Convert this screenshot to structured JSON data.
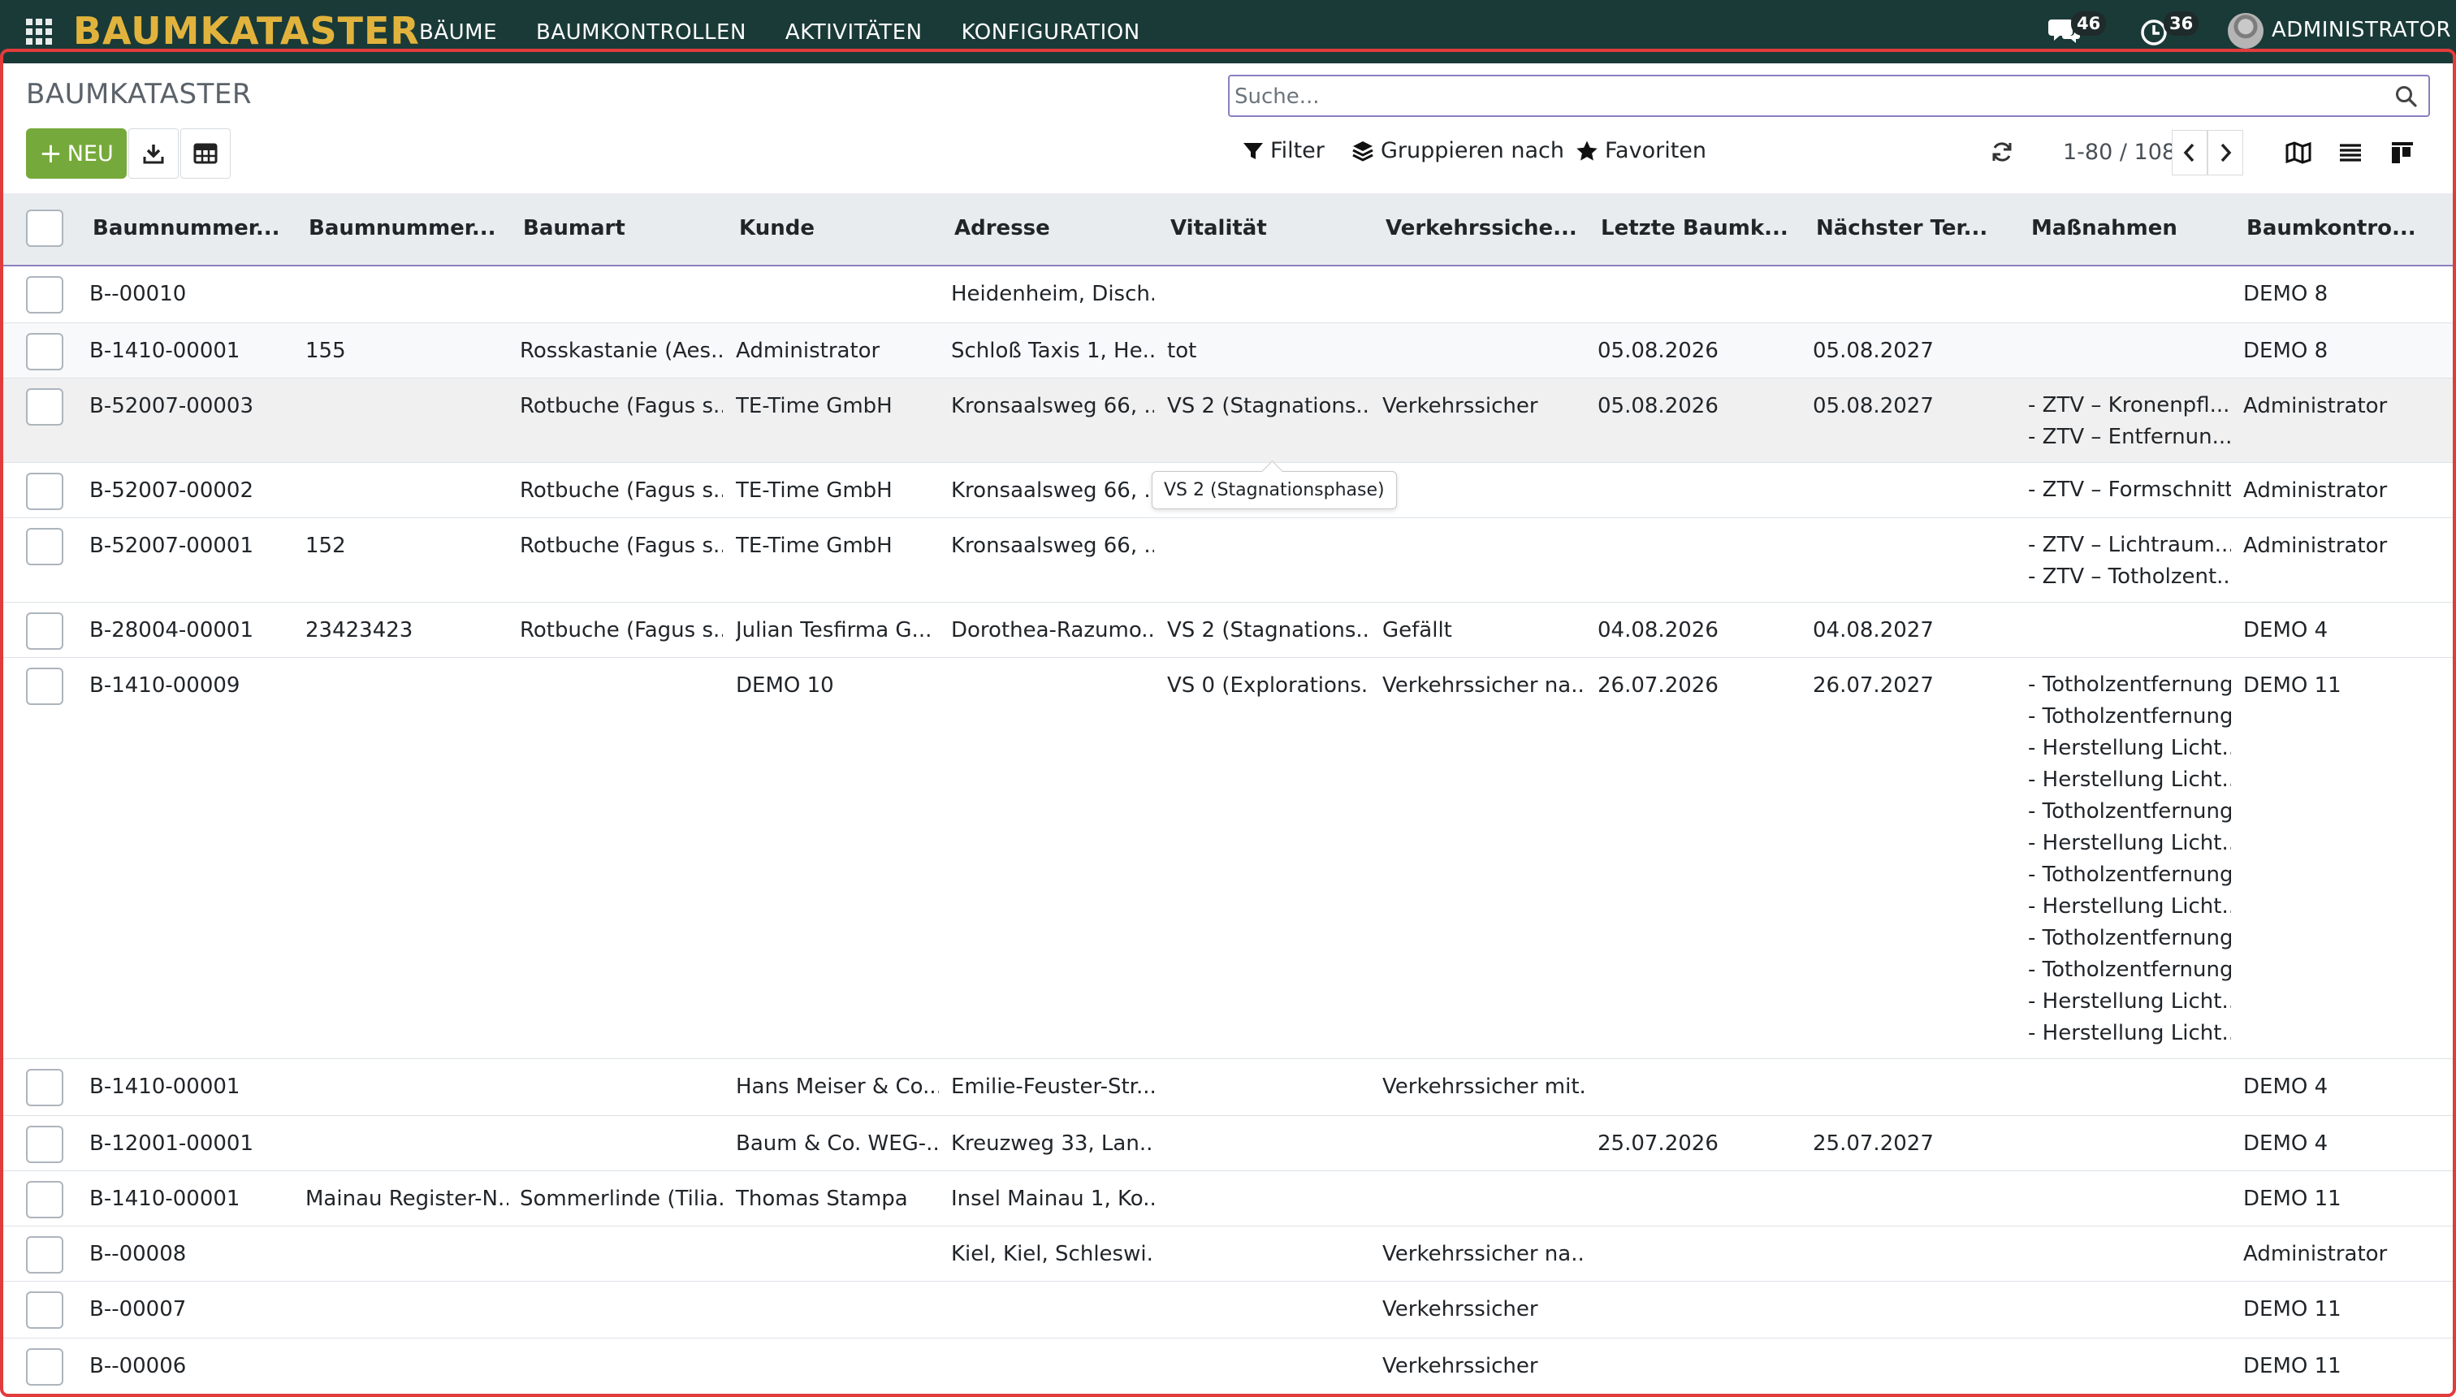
{
  "app": {
    "brand": "BAUMKATASTER",
    "menu": [
      "BÄUME",
      "BAUMKONTROLLEN",
      "AKTIVITÄTEN",
      "KONFIGURATION"
    ],
    "messages_count": "46",
    "activities_count": "36",
    "user": "ADMINISTRATOR"
  },
  "control": {
    "breadcrumb": "BAUMKATASTER",
    "search_placeholder": "Suche...",
    "new_label": "NEU",
    "filter_label": "Filter",
    "group_label": "Gruppieren nach",
    "favorites_label": "Favoriten",
    "pager": "1-80 / 108"
  },
  "columns": [
    "Baumnummer...",
    "Baumnummer...",
    "Baumart",
    "Kunde",
    "Adresse",
    "Vitalität",
    "Verkehrssiche...",
    "Letzte Baumk...",
    "Nächster Ter...",
    "Maßnahmen",
    "Baumkontro..."
  ],
  "rows": [
    {
      "c": [
        "B--00010",
        "",
        "",
        "",
        "Heidenheim, Disch...",
        "",
        "",
        "",
        "",
        "",
        "DEMO 8"
      ],
      "m": []
    },
    {
      "c": [
        "B-1410-00001",
        "155",
        "Rosskastanie (Aes...",
        "Administrator",
        "Schloß Taxis 1, He...",
        "tot",
        "",
        "05.08.2026",
        "05.08.2027",
        "",
        "DEMO 8"
      ],
      "m": []
    },
    {
      "c": [
        "B-52007-00003",
        "",
        "Rotbuche (Fagus s...",
        "TE-Time GmbH",
        "Kronsaalsweg 66, ...",
        "VS 2 (Stagnations...",
        "Verkehrssicher",
        "05.08.2026",
        "05.08.2027",
        "",
        "Administrator"
      ],
      "m": [
        "- ZTV – Kronenpfl...",
        "- ZTV – Entfernun..."
      ]
    },
    {
      "c": [
        "B-52007-00002",
        "",
        "Rotbuche (Fagus s...",
        "TE-Time GmbH",
        "Kronsaalsweg 66, ...",
        "",
        "",
        "",
        "",
        "",
        "Administrator"
      ],
      "m": [
        "- ZTV – Formschnitt"
      ]
    },
    {
      "c": [
        "B-52007-00001",
        "152",
        "Rotbuche (Fagus s...",
        "TE-Time GmbH",
        "Kronsaalsweg 66, ...",
        "",
        "",
        "",
        "",
        "",
        "Administrator"
      ],
      "m": [
        "- ZTV – Lichtraum...",
        "- ZTV – Totholzent..."
      ]
    },
    {
      "c": [
        "B-28004-00001",
        "23423423",
        "Rotbuche (Fagus s...",
        "Julian Tesfirma G...",
        "Dorothea-Razumo...",
        "VS 2 (Stagnations...",
        "Gefällt",
        "04.08.2026",
        "04.08.2027",
        "",
        "DEMO 4"
      ],
      "m": []
    },
    {
      "c": [
        "B-1410-00009",
        "",
        "",
        "DEMO 10",
        "",
        "VS 0 (Explorations...",
        "Verkehrssicher na...",
        "26.07.2026",
        "26.07.2027",
        "",
        "DEMO 11"
      ],
      "m": [
        "- Totholzentfernung",
        "- Totholzentfernung",
        "- Herstellung Licht...",
        "- Herstellung Licht...",
        "- Totholzentfernung",
        "- Herstellung Licht...",
        "- Totholzentfernung",
        "- Herstellung Licht...",
        "- Totholzentfernung",
        "- Totholzentfernung",
        "- Herstellung Licht...",
        "- Herstellung Licht..."
      ]
    },
    {
      "c": [
        "B-1410-00001",
        "",
        "",
        "Hans Meiser & Co....",
        "Emilie-Feuster-Str...",
        "",
        "Verkehrssicher mit...",
        "",
        "",
        "",
        "DEMO 4"
      ],
      "m": []
    },
    {
      "c": [
        "B-12001-00001",
        "",
        "",
        "Baum & Co. WEG-...",
        "Kreuzweg 33, Lan...",
        "",
        "",
        "25.07.2026",
        "25.07.2027",
        "",
        "DEMO 4"
      ],
      "m": []
    },
    {
      "c": [
        "B-1410-00001",
        "Mainau Register-N...",
        "Sommerlinde (Tilia...",
        "Thomas Stampa",
        "Insel Mainau 1, Ko...",
        "",
        "",
        "",
        "",
        "",
        "DEMO 11"
      ],
      "m": []
    },
    {
      "c": [
        "B--00008",
        "",
        "",
        "",
        "Kiel, Kiel, Schleswi...",
        "",
        "Verkehrssicher na...",
        "",
        "",
        "",
        "Administrator"
      ],
      "m": []
    },
    {
      "c": [
        "B--00007",
        "",
        "",
        "",
        "",
        "",
        "Verkehrssicher",
        "",
        "",
        "",
        "DEMO 11"
      ],
      "m": []
    },
    {
      "c": [
        "B--00006",
        "",
        "",
        "",
        "",
        "",
        "Verkehrssicher",
        "",
        "",
        "",
        "DEMO 11"
      ],
      "m": []
    }
  ],
  "tooltip": "VS 2 (Stagnationsphase)",
  "colors": {
    "navbar": "#1a3a38",
    "brand": "#e2b33c",
    "primary": "#76a93b",
    "frame": "#e23b3b"
  }
}
